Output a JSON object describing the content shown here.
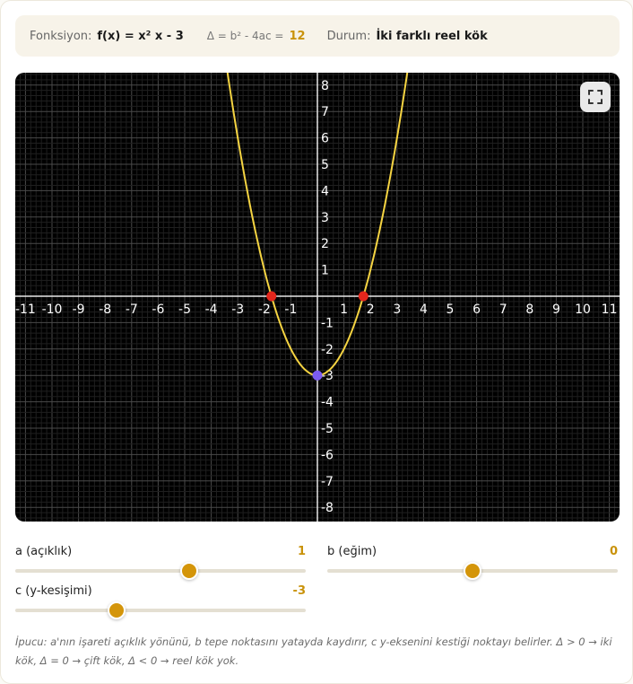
{
  "info": {
    "function_label": "Fonksiyon:",
    "function_value": "f(x) = x² x - 3",
    "delta_label": "Δ = b² - 4ac =",
    "delta_value": "12",
    "status_label": "Durum:",
    "status_value": "İki farklı reel kök"
  },
  "graph": {
    "x_range": [
      -11,
      11
    ],
    "y_range": [
      -8,
      8
    ],
    "x_ticks": [
      "-11",
      "-10",
      "-9",
      "-8",
      "-7",
      "-6",
      "-5",
      "-4",
      "-3",
      "-2",
      "-1",
      "1",
      "2",
      "3",
      "4",
      "5",
      "6",
      "7",
      "8",
      "9",
      "10",
      "11"
    ],
    "y_ticks": [
      "8",
      "7",
      "6",
      "5",
      "4",
      "3",
      "2",
      "1",
      "-1",
      "-2",
      "-3",
      "-4",
      "-5",
      "-6",
      "-7",
      "-8"
    ],
    "coefficients": {
      "a": 1,
      "b": 0,
      "c": -3
    },
    "roots": [
      -1.732,
      1.732
    ],
    "y_intercept": -3,
    "colors": {
      "background": "#000000",
      "curve": "#f5d442",
      "root": "#e3261c",
      "intercept": "#7b5cf0",
      "axis": "#e8e8e8",
      "grid": "#4a4a4a"
    },
    "fullscreen_icon": "fullscreen-icon"
  },
  "sliders": {
    "a": {
      "label": "a (açıklık)",
      "value": "1",
      "min": -5,
      "max": 5,
      "num": 1
    },
    "b": {
      "label": "b (eğim)",
      "value": "0",
      "min": -5,
      "max": 5,
      "num": 0
    },
    "c": {
      "label": "c (y-kesişimi)",
      "value": "-3",
      "min": -10,
      "max": 10,
      "num": -3
    }
  },
  "hint": "İpucu: a'nın işareti açıklık yönünü, b tepe noktasını yatayda kaydırır, c y-eksenini kestiği noktayı belirler. Δ > 0 → iki kök, Δ = 0 → çift kök, Δ < 0 → reel kök yok."
}
